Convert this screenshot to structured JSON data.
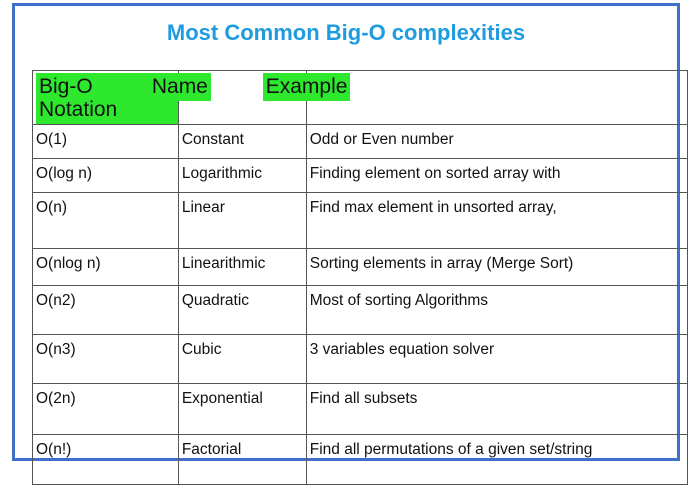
{
  "title": "Most Common Big-O complexities",
  "table": {
    "headers": {
      "notation": "Big-O Notation",
      "name": "Name",
      "example": "Example"
    },
    "rows": [
      {
        "notation": "O(1)",
        "name": "Constant",
        "example": "Odd or Even number"
      },
      {
        "notation": "O(log n)",
        "name": "Logarithmic",
        "example": "Finding element on sorted array with"
      },
      {
        "notation": "O(n)",
        "name": "Linear",
        "example": "Find max element in unsorted array,"
      },
      {
        "notation": "O(nlog n)",
        "name": "Linearithmic",
        "example": "Sorting elements in array (Merge Sort)"
      },
      {
        "notation": "O(n2)",
        "name": "Quadratic",
        "example": "Most of sorting Algorithms"
      },
      {
        "notation": "O(n3)",
        "name": "Cubic",
        "example": "3 variables equation solver"
      },
      {
        "notation": "O(2n)",
        "name": "Exponential",
        "example": "Find all subsets"
      },
      {
        "notation": "O(n!)",
        "name": "Factorial",
        "example": "Find all permutations of a given set/string"
      }
    ]
  },
  "colors": {
    "title": "#1f9be0",
    "header_highlight": "#2ee82e",
    "frame_border": "#3f6fc8"
  }
}
